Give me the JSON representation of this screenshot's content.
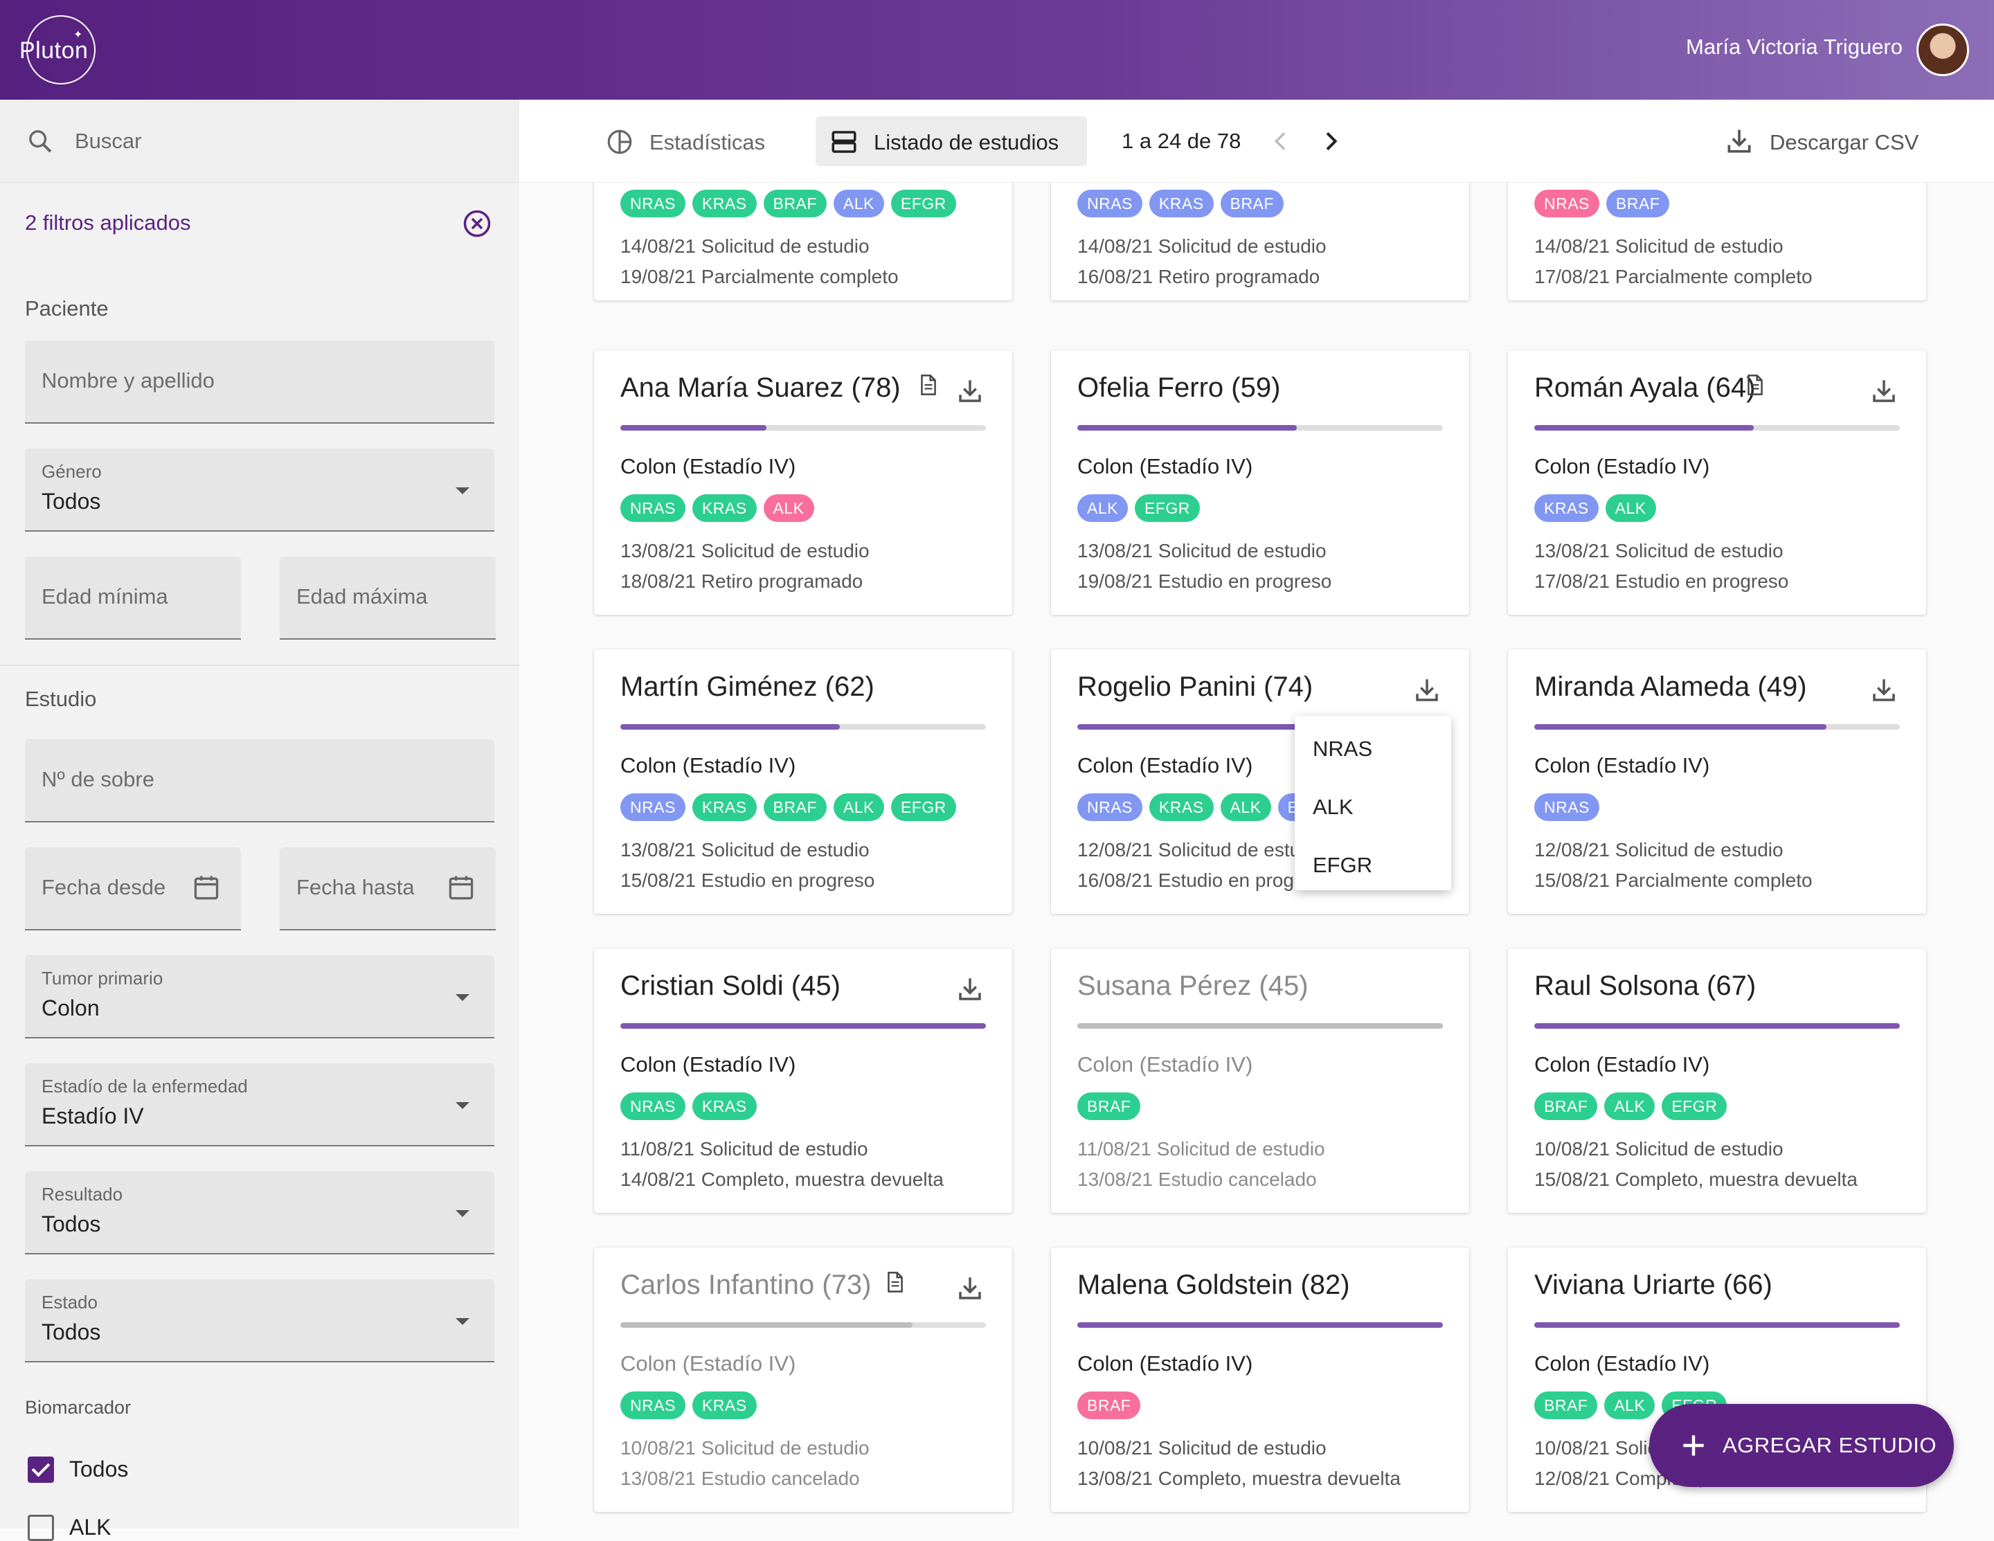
{
  "app": {
    "logo_text": "Pluton",
    "user_name": "María Victoria Triguero"
  },
  "sidebar": {
    "search_placeholder": "Buscar",
    "filters_applied": "2 filtros aplicados",
    "patient_section": "Paciente",
    "name_placeholder": "Nombre y apellido",
    "gender": {
      "label": "Género",
      "value": "Todos"
    },
    "age_min_placeholder": "Edad mínima",
    "age_max_placeholder": "Edad máxima",
    "study_section": "Estudio",
    "envelope_placeholder": "Nº de sobre",
    "date_from_placeholder": "Fecha desde",
    "date_to_placeholder": "Fecha hasta",
    "primary_tumor": {
      "label": "Tumor primario",
      "value": "Colon"
    },
    "disease_stage": {
      "label": "Estadío de la enfermedad",
      "value": "Estadío IV"
    },
    "result": {
      "label": "Resultado",
      "value": "Todos"
    },
    "state": {
      "label": "Estado",
      "value": "Todos"
    },
    "biomarker_label": "Biomarcador",
    "biomarker_options": [
      {
        "label": "Todos",
        "checked": true
      },
      {
        "label": "ALK",
        "checked": false
      }
    ]
  },
  "toolbar": {
    "tab_stats": "Estadísticas",
    "tab_list": "Listado de estudios",
    "pagination": "1 a 24 de 78",
    "download_csv": "Descargar CSV"
  },
  "top_cards": [
    {
      "tags": [
        {
          "t": "NRAS",
          "c": "g"
        },
        {
          "t": "KRAS",
          "c": "g"
        },
        {
          "t": "BRAF",
          "c": "g"
        },
        {
          "t": "ALK",
          "c": "b"
        },
        {
          "t": "EFGR",
          "c": "g"
        }
      ],
      "line1": "14/08/21 Solicitud de estudio",
      "line2": "19/08/21 Parcialmente completo"
    },
    {
      "tags": [
        {
          "t": "NRAS",
          "c": "b"
        },
        {
          "t": "KRAS",
          "c": "b"
        },
        {
          "t": "BRAF",
          "c": "b"
        }
      ],
      "line1": "14/08/21 Solicitud de estudio",
      "line2": "16/08/21 Retiro programado"
    },
    {
      "tags": [
        {
          "t": "NRAS",
          "c": "p"
        },
        {
          "t": "BRAF",
          "c": "b"
        }
      ],
      "line1": "14/08/21 Solicitud de estudio",
      "line2": "17/08/21 Parcialmente completo"
    }
  ],
  "cards": [
    {
      "name": "Ana María Suarez (78)",
      "doc": true,
      "download": true,
      "progress": 0.4,
      "dim": false,
      "diag": "Colon (Estadío IV)",
      "tags": [
        {
          "t": "NRAS",
          "c": "g"
        },
        {
          "t": "KRAS",
          "c": "g"
        },
        {
          "t": "ALK",
          "c": "p"
        }
      ],
      "line1": "13/08/21 Solicitud de estudio",
      "line2": "18/08/21 Retiro programado"
    },
    {
      "name": "Ofelia Ferro (59)",
      "doc": false,
      "download": false,
      "progress": 0.6,
      "dim": false,
      "diag": "Colon (Estadío IV)",
      "tags": [
        {
          "t": "ALK",
          "c": "b"
        },
        {
          "t": "EFGR",
          "c": "g"
        }
      ],
      "line1": "13/08/21 Solicitud de estudio",
      "line2": "19/08/21 Estudio en progreso"
    },
    {
      "name": "Román Ayala (64)",
      "doc": true,
      "download": true,
      "progress": 0.6,
      "dim": false,
      "diag": "Colon (Estadío IV)",
      "tags": [
        {
          "t": "KRAS",
          "c": "b"
        },
        {
          "t": "ALK",
          "c": "g"
        }
      ],
      "line1": "13/08/21 Solicitud de estudio",
      "line2": "17/08/21 Estudio en progreso"
    },
    {
      "name": "Martín Giménez (62)",
      "doc": false,
      "download": false,
      "progress": 0.6,
      "dim": false,
      "diag": "Colon (Estadío IV)",
      "tags": [
        {
          "t": "NRAS",
          "c": "b"
        },
        {
          "t": "KRAS",
          "c": "g"
        },
        {
          "t": "BRAF",
          "c": "g"
        },
        {
          "t": "ALK",
          "c": "g"
        },
        {
          "t": "EFGR",
          "c": "g"
        }
      ],
      "line1": "13/08/21 Solicitud de estudio",
      "line2": "15/08/21 Estudio en progreso"
    },
    {
      "name": "Rogelio Panini (74)",
      "doc": false,
      "download": true,
      "progress": 0.6,
      "dim": false,
      "diag": "Colon (Estadío IV)",
      "tags": [
        {
          "t": "NRAS",
          "c": "b"
        },
        {
          "t": "KRAS",
          "c": "g"
        },
        {
          "t": "ALK",
          "c": "g"
        },
        {
          "t": "EFGR",
          "c": "b"
        }
      ],
      "line1": "12/08/21 Solicitud de estudio",
      "line2": "16/08/21 Estudio en progreso"
    },
    {
      "name": "Miranda Alameda (49)",
      "doc": false,
      "download": true,
      "progress": 0.8,
      "dim": false,
      "diag": "Colon (Estadío IV)",
      "tags": [
        {
          "t": "NRAS",
          "c": "b"
        }
      ],
      "line1": "12/08/21 Solicitud de estudio",
      "line2": "15/08/21 Parcialmente completo"
    },
    {
      "name": "Cristian Soldi (45)",
      "doc": false,
      "download": true,
      "progress": 1.0,
      "dim": false,
      "diag": "Colon (Estadío IV)",
      "tags": [
        {
          "t": "NRAS",
          "c": "g"
        },
        {
          "t": "KRAS",
          "c": "g"
        }
      ],
      "line1": "11/08/21 Solicitud de estudio",
      "line2": "14/08/21 Completo, muestra devuelta"
    },
    {
      "name": "Susana Pérez (45)",
      "doc": false,
      "download": false,
      "progress": 1.0,
      "dim": true,
      "diag": "Colon (Estadío IV)",
      "tags": [
        {
          "t": "BRAF",
          "c": "g"
        }
      ],
      "line1": "11/08/21 Solicitud de estudio",
      "line2": "13/08/21 Estudio cancelado"
    },
    {
      "name": "Raul Solsona (67)",
      "doc": false,
      "download": false,
      "progress": 1.0,
      "dim": false,
      "diag": "Colon (Estadío IV)",
      "tags": [
        {
          "t": "BRAF",
          "c": "g"
        },
        {
          "t": "ALK",
          "c": "g"
        },
        {
          "t": "EFGR",
          "c": "g"
        }
      ],
      "line1": "10/08/21 Solicitud de estudio",
      "line2": "15/08/21 Completo, muestra devuelta"
    },
    {
      "name": "Carlos Infantino (73)",
      "doc": true,
      "download": true,
      "progress": 0.8,
      "dim": true,
      "diag": "Colon (Estadío IV)",
      "tags": [
        {
          "t": "NRAS",
          "c": "g"
        },
        {
          "t": "KRAS",
          "c": "g"
        }
      ],
      "line1": "10/08/21 Solicitud de estudio",
      "line2": "13/08/21 Estudio cancelado"
    },
    {
      "name": "Malena Goldstein (82)",
      "doc": false,
      "download": false,
      "progress": 1.0,
      "dim": false,
      "diag": "Colon (Estadío IV)",
      "tags": [
        {
          "t": "BRAF",
          "c": "p"
        }
      ],
      "line1": "10/08/21 Solicitud de estudio",
      "line2": "13/08/21 Completo, muestra devuelta"
    },
    {
      "name": "Viviana Uriarte (66)",
      "doc": false,
      "download": false,
      "progress": 1.0,
      "dim": false,
      "diag": "Colon (Estadío IV)",
      "tags": [
        {
          "t": "BRAF",
          "c": "g"
        },
        {
          "t": "ALK",
          "c": "g"
        },
        {
          "t": "EFGR",
          "c": "g"
        }
      ],
      "line1": "10/08/21 Solicitud de estudio",
      "line2": "12/08/21 Completo, muestra devuelta"
    }
  ],
  "dropdown_menu": [
    "NRAS",
    "ALK",
    "EFGR"
  ],
  "fab_label": "AGREGAR ESTUDIO",
  "colors": {
    "brand": "#5b2381",
    "progress": "#7e57b0",
    "tag_green": "#2ccf8f",
    "tag_blue": "#8197f2",
    "tag_pink": "#f86f9c"
  }
}
